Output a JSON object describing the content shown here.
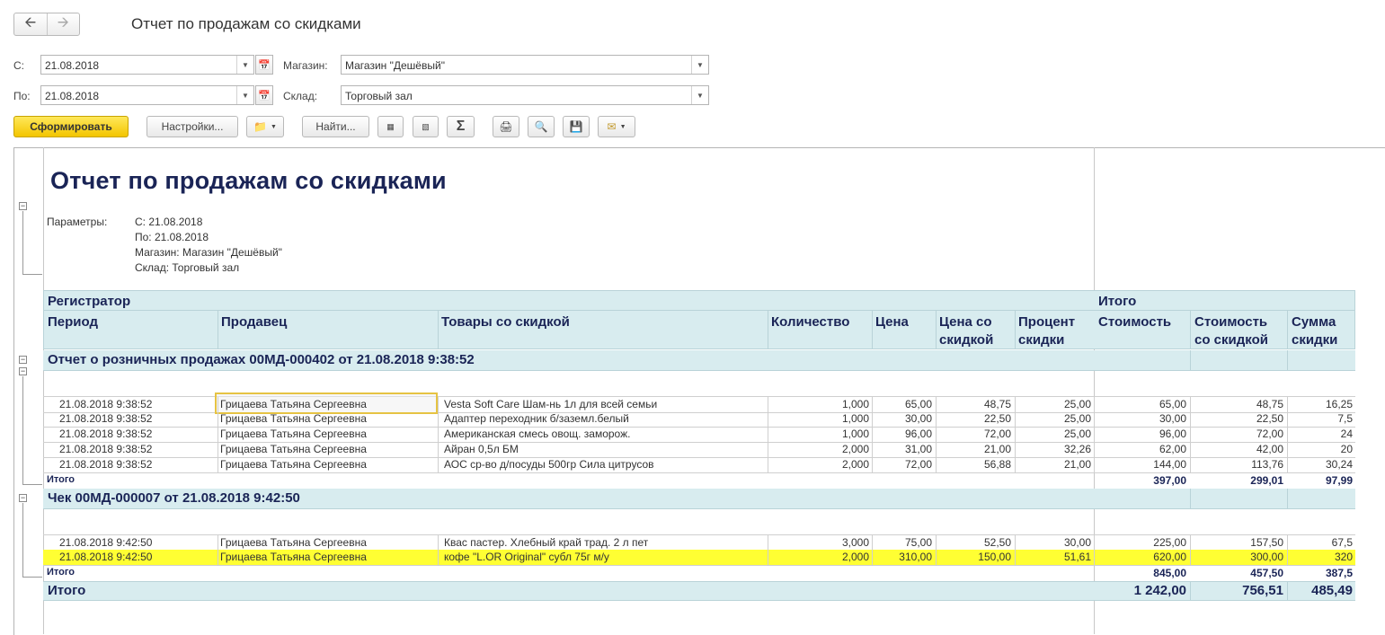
{
  "window": {
    "title": "Отчет по продажам со скидками"
  },
  "nav": {
    "back_icon": "arrow-left-icon",
    "forward_icon": "arrow-right-icon"
  },
  "filters": {
    "from_label": "С:",
    "from_value": "21.08.2018",
    "to_label": "По:",
    "to_value": "21.08.2018",
    "store_label": "Магазин:",
    "store_value": "Магазин \"Дешёвый\"",
    "warehouse_label": "Склад:",
    "warehouse_value": "Торговый зал"
  },
  "toolbar": {
    "generate": "Сформировать",
    "settings": "Настройки...",
    "find": "Найти...",
    "sigma": "Σ"
  },
  "report": {
    "title": "Отчет по продажам со скидками",
    "params_label": "Параметры:",
    "params": [
      "С: 21.08.2018",
      "По: 21.08.2018",
      "Магазин: Магазин \"Дешёвый\"",
      "Склад: Торговый зал"
    ],
    "header": {
      "registrar": "Регистратор",
      "totals": "Итого",
      "period": "Период",
      "seller": "Продавец",
      "goods": "Товары со скидкой",
      "qty": "Количество",
      "price": "Цена",
      "price_disc_1": "Цена со",
      "price_disc_2": "скидкой",
      "pct_1": "Процент",
      "pct_2": "скидки",
      "cost": "Стоимость",
      "cost_disc_1": "Стоимость",
      "cost_disc_2": "со скидкой",
      "sum_disc_1": "Сумма",
      "sum_disc_2": "скидки"
    },
    "groups": [
      {
        "title": "Отчет о розничных продажах 00МД-000402 от 21.08.2018 9:38:52",
        "rows": [
          [
            "21.08.2018 9:38:52",
            "Грицаева Татьяна Сергеевна",
            "Vesta Soft Care Шам-нь 1л для всей семьи",
            "1,000",
            "65,00",
            "48,75",
            "25,00",
            "65,00",
            "48,75",
            "16,25"
          ],
          [
            "21.08.2018 9:38:52",
            "Грицаева Татьяна Сергеевна",
            "Адаптер переходник б/заземл.белый",
            "1,000",
            "30,00",
            "22,50",
            "25,00",
            "30,00",
            "22,50",
            "7,5"
          ],
          [
            "21.08.2018 9:38:52",
            "Грицаева Татьяна Сергеевна",
            "Американская смесь овощ. заморож.",
            "1,000",
            "96,00",
            "72,00",
            "25,00",
            "96,00",
            "72,00",
            "24"
          ],
          [
            "21.08.2018 9:38:52",
            "Грицаева Татьяна Сергеевна",
            "Айран 0,5л БМ",
            "2,000",
            "31,00",
            "21,00",
            "32,26",
            "62,00",
            "42,00",
            "20"
          ],
          [
            "21.08.2018 9:38:52",
            "Грицаева Татьяна Сергеевна",
            "АОС ср-во д/посуды 500гр Сила цитрусов",
            "2,000",
            "72,00",
            "56,88",
            "21,00",
            "144,00",
            "113,76",
            "30,24"
          ]
        ],
        "total_label": "Итого",
        "total": [
          "397,00",
          "299,01",
          "97,99"
        ]
      },
      {
        "title": "Чек 00МД-000007 от 21.08.2018 9:42:50",
        "rows": [
          [
            "21.08.2018 9:42:50",
            "Грицаева Татьяна Сергеевна",
            "Квас пастер. Хлебный край трад. 2 л пет",
            "3,000",
            "75,00",
            "52,50",
            "30,00",
            "225,00",
            "157,50",
            "67,5"
          ],
          [
            "21.08.2018 9:42:50",
            "Грицаева Татьяна Сергеевна",
            "кофе \"L.OR Original\" субл 75г м/у",
            "2,000",
            "310,00",
            "150,00",
            "51,61",
            "620,00",
            "300,00",
            "320"
          ]
        ],
        "total_label": "Итого",
        "total": [
          "845,00",
          "457,50",
          "387,5"
        ]
      }
    ],
    "grand_total_label": "Итого",
    "grand_total": [
      "1 242,00",
      "756,51",
      "485,49"
    ]
  }
}
